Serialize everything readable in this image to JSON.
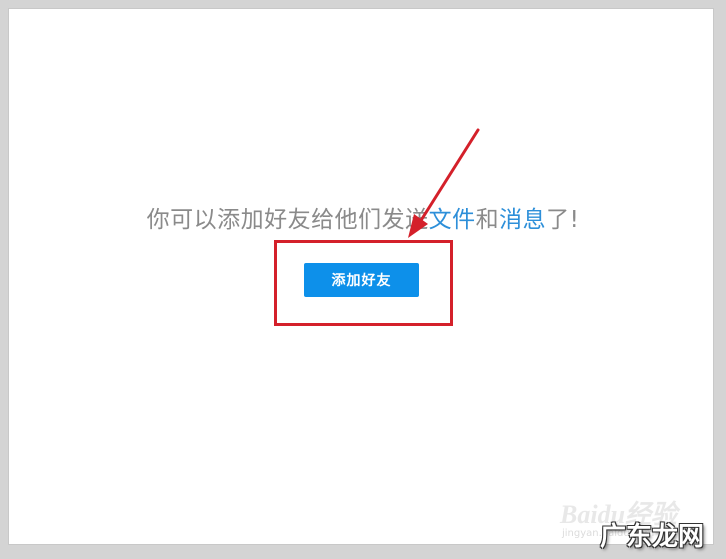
{
  "empty_state": {
    "message_prefix": "你可以添加好友给他们发送",
    "link_files": "文件",
    "message_and": "和",
    "link_messages": "消息",
    "message_suffix": "了!"
  },
  "actions": {
    "add_friend_label": "添加好友"
  },
  "watermark": {
    "baidu": "Baidu经验",
    "baidu_sub": "jingyan.baidu.com",
    "site": "广东龙网"
  },
  "colors": {
    "button": "#0d90ea",
    "link": "#2d8fd9",
    "annotation_red": "#d4202a"
  }
}
